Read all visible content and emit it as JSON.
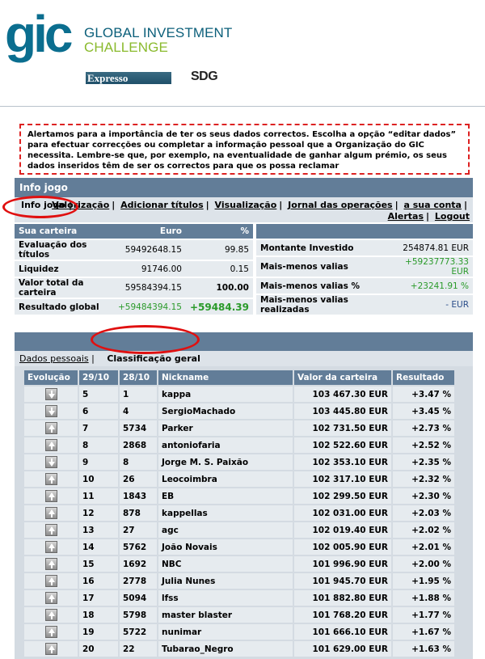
{
  "header": {
    "logo_text": "gic",
    "logo_line1": "GLOBAL INVESTMENT",
    "logo_line2": "CHALLENGE",
    "partner1": "Expresso",
    "partner2": "SDG"
  },
  "alert": "Alertamos para a importância de ter os seus dados correctos. Escolha a opção “editar dados” para efectuar correcções ou completar a informação pessoal que a Organização do GIC necessita. Lembre-se que, por exemplo, na eventualidade de ganhar algum prémio, os seus dados inseridos têm de ser os correctos para que os possa reclamar",
  "info": {
    "title": "Info jogo",
    "nav": {
      "active": "Info jogo",
      "items": [
        "Valorização",
        "Adicionar títulos",
        "Visualização",
        "Jornal das operações",
        "a sua conta",
        "Alertas",
        "Logout"
      ]
    },
    "left_table": {
      "headers": [
        "Sua carteira",
        "Euro",
        "%"
      ],
      "rows": [
        {
          "label": "Evaluação dos títulos",
          "euro": "59492648.15",
          "pct": "99.85"
        },
        {
          "label": "Liquidez",
          "euro": "91746.00",
          "pct": "0.15"
        },
        {
          "label": "Valor total da carteira",
          "euro": "59584394.15",
          "pct": "100.00"
        },
        {
          "label": "Resultado global",
          "euro": "+59484394.15",
          "pct": "+59484.39"
        }
      ]
    },
    "right_table": {
      "rows": [
        {
          "label": "Montante Investido",
          "value": "254874.81 EUR"
        },
        {
          "label": "Mais-menos valias",
          "value": "+59237773.33 EUR"
        },
        {
          "label": "Mais-menos valias %",
          "value": "+23241.91 %"
        },
        {
          "label": "Mais-menos valias realizadas",
          "value": "- EUR"
        }
      ]
    }
  },
  "ranking_tabs": {
    "dados": "Dados pessoais",
    "classificacao": "Classificação geral"
  },
  "ranking": {
    "headers": [
      "Evolução",
      "29/10",
      "28/10",
      "Nickname",
      "Valor da carteira",
      "Resultado"
    ],
    "rows": [
      {
        "dir": "down",
        "d1": "5",
        "d2": "1",
        "nick": "kappa",
        "valor": "103 467.30 EUR",
        "res": "+3.47 %"
      },
      {
        "dir": "down",
        "d1": "6",
        "d2": "4",
        "nick": "SergioMachado",
        "valor": "103 445.80 EUR",
        "res": "+3.45 %"
      },
      {
        "dir": "up",
        "d1": "7",
        "d2": "5734",
        "nick": "Parker",
        "valor": "102 731.50 EUR",
        "res": "+2.73 %"
      },
      {
        "dir": "up",
        "d1": "8",
        "d2": "2868",
        "nick": "antoniofaria",
        "valor": "102 522.60 EUR",
        "res": "+2.52 %"
      },
      {
        "dir": "down",
        "d1": "9",
        "d2": "8",
        "nick": "Jorge M. S. Paixão",
        "valor": "102 353.10 EUR",
        "res": "+2.35 %"
      },
      {
        "dir": "up",
        "d1": "10",
        "d2": "26",
        "nick": "Leocoimbra",
        "valor": "102 317.10 EUR",
        "res": "+2.32 %"
      },
      {
        "dir": "up",
        "d1": "11",
        "d2": "1843",
        "nick": "EB",
        "valor": "102 299.50 EUR",
        "res": "+2.30 %"
      },
      {
        "dir": "up",
        "d1": "12",
        "d2": "878",
        "nick": "kappellas",
        "valor": "102 031.00 EUR",
        "res": "+2.03 %"
      },
      {
        "dir": "up",
        "d1": "13",
        "d2": "27",
        "nick": "agc",
        "valor": "102 019.40 EUR",
        "res": "+2.02 %"
      },
      {
        "dir": "up",
        "d1": "14",
        "d2": "5762",
        "nick": "João Novais",
        "valor": "102 005.90 EUR",
        "res": "+2.01 %"
      },
      {
        "dir": "up",
        "d1": "15",
        "d2": "1692",
        "nick": "NBC",
        "valor": "101 996.90 EUR",
        "res": "+2.00 %"
      },
      {
        "dir": "up",
        "d1": "16",
        "d2": "2778",
        "nick": "Julia Nunes",
        "valor": "101 945.70 EUR",
        "res": "+1.95 %"
      },
      {
        "dir": "up",
        "d1": "17",
        "d2": "5094",
        "nick": "lfss",
        "valor": "101 882.80 EUR",
        "res": "+1.88 %"
      },
      {
        "dir": "up",
        "d1": "18",
        "d2": "5798",
        "nick": "master blaster",
        "valor": "101 768.20 EUR",
        "res": "+1.77 %"
      },
      {
        "dir": "up",
        "d1": "19",
        "d2": "5722",
        "nick": "nunimar",
        "valor": "101 666.10 EUR",
        "res": "+1.67 %"
      },
      {
        "dir": "up",
        "d1": "20",
        "d2": "22",
        "nick": "Tubarao_Negro",
        "valor": "101 629.00 EUR",
        "res": "+1.63 %"
      }
    ]
  }
}
